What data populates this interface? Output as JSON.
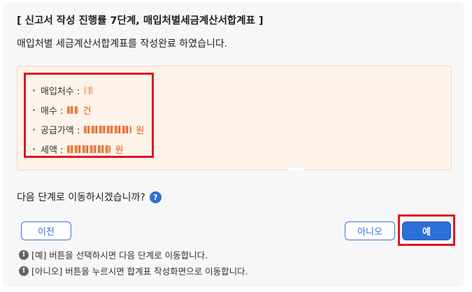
{
  "title": "[ 신고서 작성 진행률 7단계, 매입처별세금계산서합계표 ]",
  "subtitle": "매입처별 세금계산서합계표를 작성완료 하였습니다.",
  "summary": {
    "rows": [
      {
        "label": "매입처수 :",
        "unit": ""
      },
      {
        "label": "매수 :",
        "unit": "건"
      },
      {
        "label": "공급가액 :",
        "unit": "원"
      },
      {
        "label": "세액 :",
        "unit": "원"
      }
    ]
  },
  "question": "다음 단계로 이동하시겠습니까?",
  "help_icon": "?",
  "buttons": {
    "prev": "이전",
    "no": "아니오",
    "yes": "예"
  },
  "notes": [
    "[예] 버튼을 선택하시면 다음 단계로 이동합니다.",
    "[아니오] 버튼을 누르시면 합계표 작성화면으로 이동합니다."
  ],
  "notes_icon": "!",
  "colors": {
    "accent": "#2d6fd8",
    "highlight": "#e0161d",
    "info_bg": "#fdf3ea",
    "unit": "#e35b12"
  }
}
